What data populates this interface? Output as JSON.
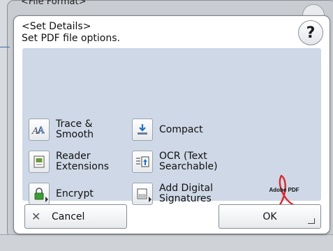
{
  "background": {
    "title": "<File Format>"
  },
  "dialog": {
    "title": "<Set Details>",
    "subtitle": "Set PDF file options.",
    "help_label": "?"
  },
  "options": [
    {
      "label": "Trace &\nSmooth",
      "icon": "trace-smooth-icon",
      "has_submenu": false
    },
    {
      "label": "Compact",
      "icon": "compact-icon",
      "has_submenu": false
    },
    {
      "label": "Reader\nExtensions",
      "icon": "reader-extensions-icon",
      "has_submenu": false
    },
    {
      "label": "OCR (Text\nSearchable)",
      "icon": "ocr-icon",
      "has_submenu": false
    },
    {
      "label": "Encrypt",
      "icon": "lock-icon",
      "has_submenu": true
    },
    {
      "label": "Add Digital\nSignatures",
      "icon": "digital-signature-icon",
      "has_submenu": true
    }
  ],
  "logo": {
    "text": "Adobe PDF",
    "color": "#d7282f"
  },
  "buttons": {
    "cancel_label": "Cancel",
    "cancel_icon": "close-icon",
    "ok_label": "OK"
  },
  "colors": {
    "options_background": "#ced8e6",
    "dialog_background": "#ffffff"
  }
}
